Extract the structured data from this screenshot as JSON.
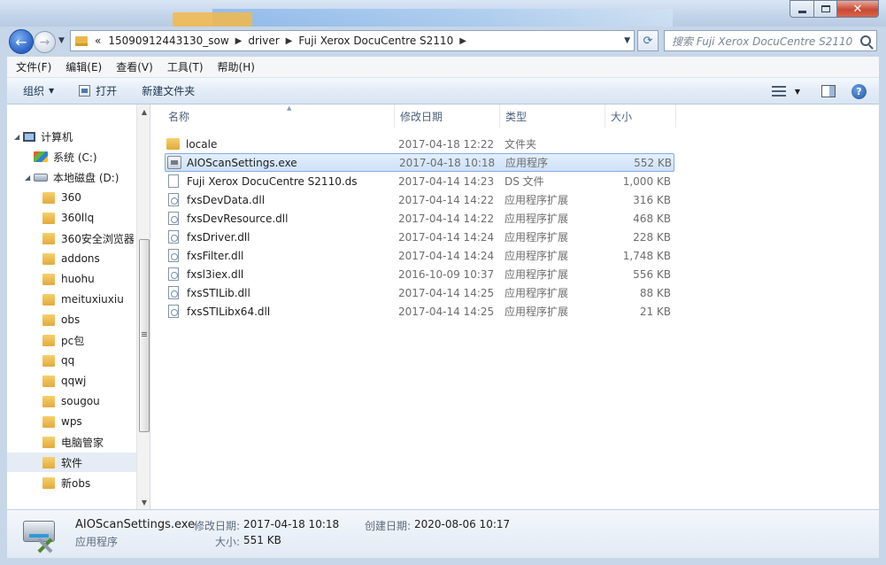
{
  "titlebar": {},
  "address": {
    "overflow_marker": "«",
    "crumbs": [
      "15090912443130_sow",
      "driver",
      "Fuji Xerox DocuCentre S2110"
    ]
  },
  "search": {
    "placeholder": "搜索 Fuji Xerox DocuCentre S2110"
  },
  "menu": [
    "文件(F)",
    "编辑(E)",
    "查看(V)",
    "工具(T)",
    "帮助(H)"
  ],
  "toolbar": {
    "organize": "组织",
    "open": "打开",
    "new_folder": "新建文件夹"
  },
  "navpane": {
    "computer": "计算机",
    "drive_c": "系统 (C:)",
    "drive_d": "本地磁盘 (D:)",
    "folders": [
      "360",
      "360llq",
      "360安全浏览器",
      "addons",
      "huohu",
      "meituxiuxiu",
      "obs",
      "pc包",
      "qq",
      "qqwj",
      "sougou",
      "wps",
      "电脑管家",
      "软件",
      "新obs"
    ],
    "selected_folder": "软件"
  },
  "columns": {
    "name": "名称",
    "date": "修改日期",
    "type": "类型",
    "size": "大小"
  },
  "files": [
    {
      "name": "locale",
      "date": "2017-04-18 12:22",
      "type": "文件夹",
      "size": "",
      "icon": "folder-icon"
    },
    {
      "name": "AIOScanSettings.exe",
      "date": "2017-04-18 10:18",
      "type": "应用程序",
      "size": "552 KB",
      "icon": "exe-icon"
    },
    {
      "name": "Fuji Xerox DocuCentre S2110.ds",
      "date": "2017-04-14 14:23",
      "type": "DS 文件",
      "size": "1,000 KB",
      "icon": "file-icon"
    },
    {
      "name": "fxsDevData.dll",
      "date": "2017-04-14 14:22",
      "type": "应用程序扩展",
      "size": "316 KB",
      "icon": "dll-icon"
    },
    {
      "name": "fxsDevResource.dll",
      "date": "2017-04-14 14:22",
      "type": "应用程序扩展",
      "size": "468 KB",
      "icon": "dll-icon"
    },
    {
      "name": "fxsDriver.dll",
      "date": "2017-04-14 14:24",
      "type": "应用程序扩展",
      "size": "228 KB",
      "icon": "dll-icon"
    },
    {
      "name": "fxsFilter.dll",
      "date": "2017-04-14 14:24",
      "type": "应用程序扩展",
      "size": "1,748 KB",
      "icon": "dll-icon"
    },
    {
      "name": "fxsl3iex.dll",
      "date": "2016-10-09 10:37",
      "type": "应用程序扩展",
      "size": "556 KB",
      "icon": "dll-icon"
    },
    {
      "name": "fxsSTILib.dll",
      "date": "2017-04-14 14:25",
      "type": "应用程序扩展",
      "size": "88 KB",
      "icon": "dll-icon"
    },
    {
      "name": "fxsSTILibx64.dll",
      "date": "2017-04-14 14:25",
      "type": "应用程序扩展",
      "size": "21 KB",
      "icon": "dll-icon"
    }
  ],
  "selected_file_index": 1,
  "details": {
    "name": "AIOScanSettings.exe",
    "type": "应用程序",
    "modified_label": "修改日期:",
    "modified": "2017-04-18 10:18",
    "created_label": "创建日期:",
    "created": "2020-08-06 10:17",
    "size_label": "大小:",
    "size": "551 KB"
  },
  "colors": {
    "selection": "#cde1f8",
    "selection_border": "#84acdd",
    "folder": "#e3a93c",
    "toolbar": "#e3ecf7"
  }
}
